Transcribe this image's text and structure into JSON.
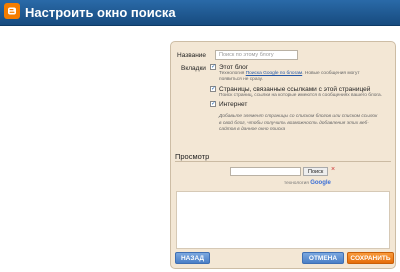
{
  "header": {
    "title": "Настроить окно поиска",
    "icon": "blogger-logo-icon"
  },
  "form": {
    "name_label": "Название",
    "name_placeholder": "Поиск по этому блогу",
    "tabs_label": "Вкладки",
    "options": [
      {
        "label": "Этот блог",
        "checked": true,
        "desc_prefix": "Технология ",
        "desc_link": "Поиска Google по блогам",
        "desc_suffix": ". Новые сообщения могут",
        "desc_line2": "появиться не сразу."
      },
      {
        "label": "Страницы, связанные ссылками с этой страницей",
        "checked": true,
        "desc_line1": "Поиск страниц, ссылки на которые имеются в сообщениях вашего блога."
      },
      {
        "label": "Интернет",
        "checked": true
      }
    ],
    "hint_lines": [
      "Добавьте элемент страницы со списком блогов или списком ссылок",
      "в свой блог, чтобы получить возможность добавления этих веб-",
      "сайтов в данное окно поиска"
    ]
  },
  "preview": {
    "heading": "Просмотр",
    "search_button": "Поиск",
    "clear_symbol": "×",
    "powered_by": "технология",
    "google": "Google"
  },
  "buttons": {
    "back": "НАЗАД",
    "cancel": "ОТМЕНА",
    "save": "СОХРАНИТЬ"
  },
  "colors": {
    "header": "#1f5a93",
    "panel": "#f3e7d5",
    "blue_button": "#5b8ed0",
    "orange_button": "#ef7c16"
  }
}
